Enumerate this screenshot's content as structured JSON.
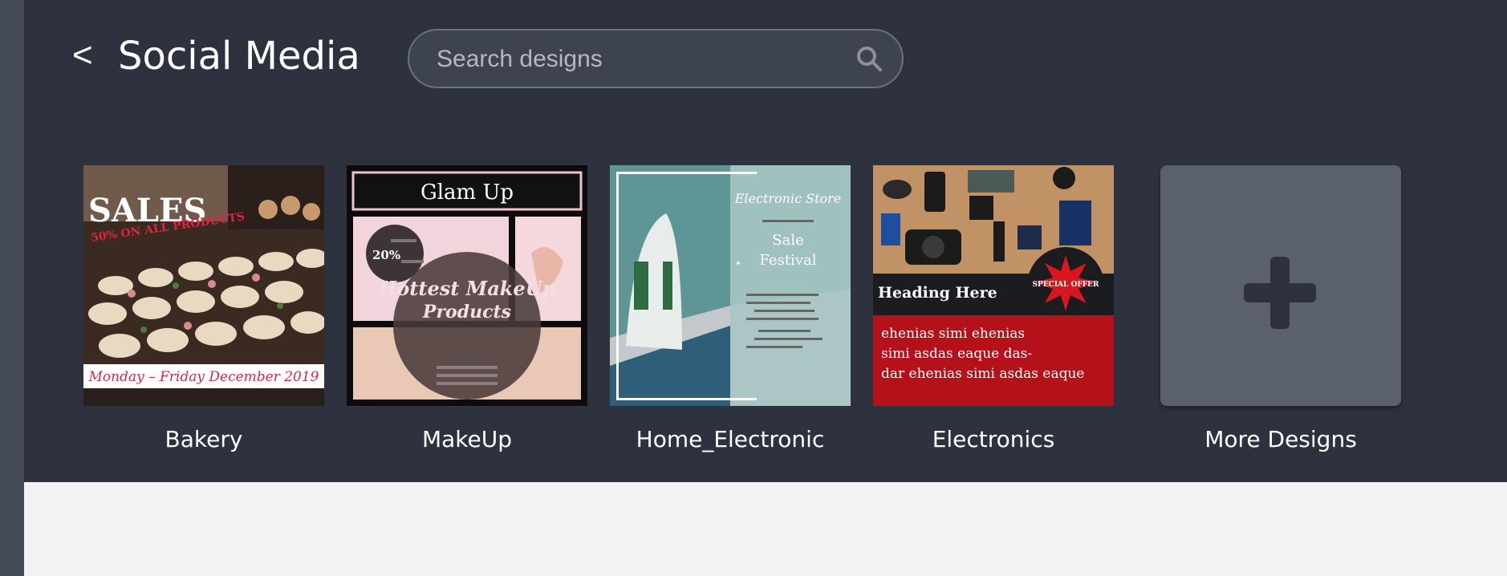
{
  "header": {
    "back_label": "<",
    "title": "Social Media",
    "search_placeholder": "Search designs",
    "search_icon": "search-icon"
  },
  "designs": [
    {
      "label": "Bakery",
      "texts": {
        "headline": "SALES",
        "subline": "50% ON ALL PRODUCTS",
        "footer": "Monday – Friday December 2019"
      }
    },
    {
      "label": "MakeUp",
      "texts": {
        "headline": "Glam Up",
        "badge": "20%",
        "line1": "Hottest MakeUp",
        "line2": "Products"
      }
    },
    {
      "label": "Home_Electronic",
      "texts": {
        "headline": "Electronic Store",
        "line1": "Sale",
        "line2": "Festival"
      }
    },
    {
      "label": "Electronics",
      "texts": {
        "heading": "Heading Here",
        "badge": "SPECIAL OFFER",
        "body1": "ehenias simi ehenias",
        "body2": "simi asdas eaque das-",
        "body3": "dar ehenias simi asdas eaque"
      }
    }
  ],
  "more": {
    "label": "More Designs",
    "icon": "plus-icon"
  },
  "colors": {
    "panel": "#2d323e",
    "rail": "#444b57",
    "tile": "#5b616c",
    "plus": "#2d323e",
    "accent_red": "#b5111b"
  }
}
